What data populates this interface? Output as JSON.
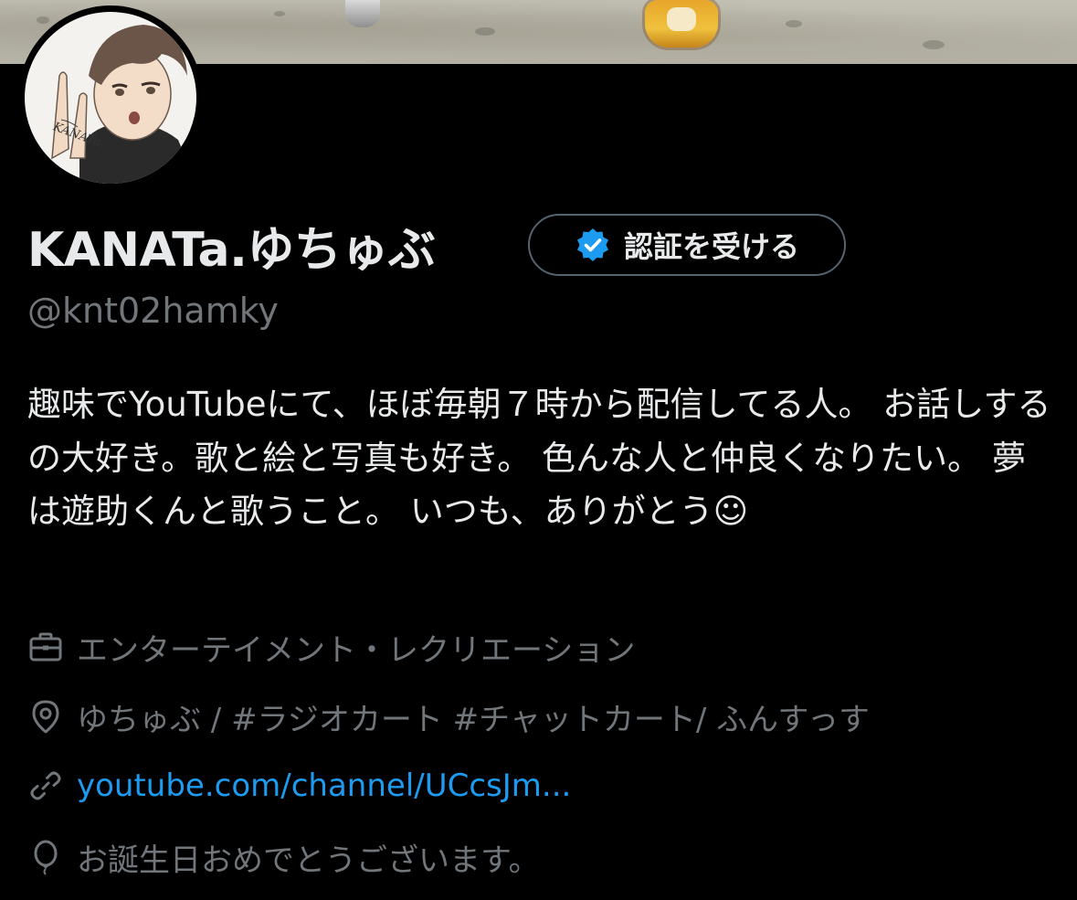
{
  "profile": {
    "display_name": "KANATa.ゆちゅぶ",
    "handle": "@knt02hamky",
    "avatar_signature": "KANATa.",
    "verify_button_label": "認証を受ける",
    "bio": "趣味でYouTubeにて、ほぼ毎朝７時から配信してる人。 お話しするの大好き。歌と絵と写真も好き。 色んな人と仲良くなりたい。 夢は遊助くんと歌うこと。 いつも、ありがとう☺"
  },
  "meta": {
    "category": "エンターテイメント・レクリエーション",
    "location": "ゆちゅぶ / #ラジオカート #チャットカート/ ふんすっす",
    "url": "youtube.com/channel/UCcsJm...",
    "birthday": "お誕生日おめでとうございます。"
  },
  "icons": {
    "verify": "verified-badge-icon",
    "category": "briefcase-icon",
    "location": "location-pin-icon",
    "url": "link-icon",
    "birthday": "balloon-icon"
  },
  "colors": {
    "background": "#000000",
    "text_primary": "#e7e9ea",
    "text_secondary": "#71767b",
    "link": "#1d9bf0",
    "verified_blue": "#1d9bf0",
    "button_border": "#536471"
  }
}
